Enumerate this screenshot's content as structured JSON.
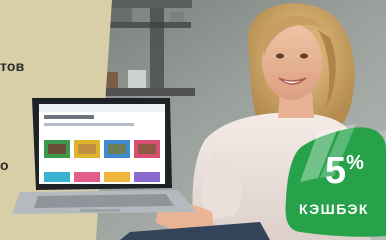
{
  "banner": {
    "text_fragment_top": "тов",
    "text_fragment_bottom": "о",
    "badge": {
      "percent": "5",
      "percent_sign": "%",
      "label": "КЭШБЭК",
      "color": "#27a24b"
    },
    "colors": {
      "beige_panel": "#d8cfa8",
      "wall": "#8f9592",
      "sweater": "#efe4e0"
    }
  }
}
